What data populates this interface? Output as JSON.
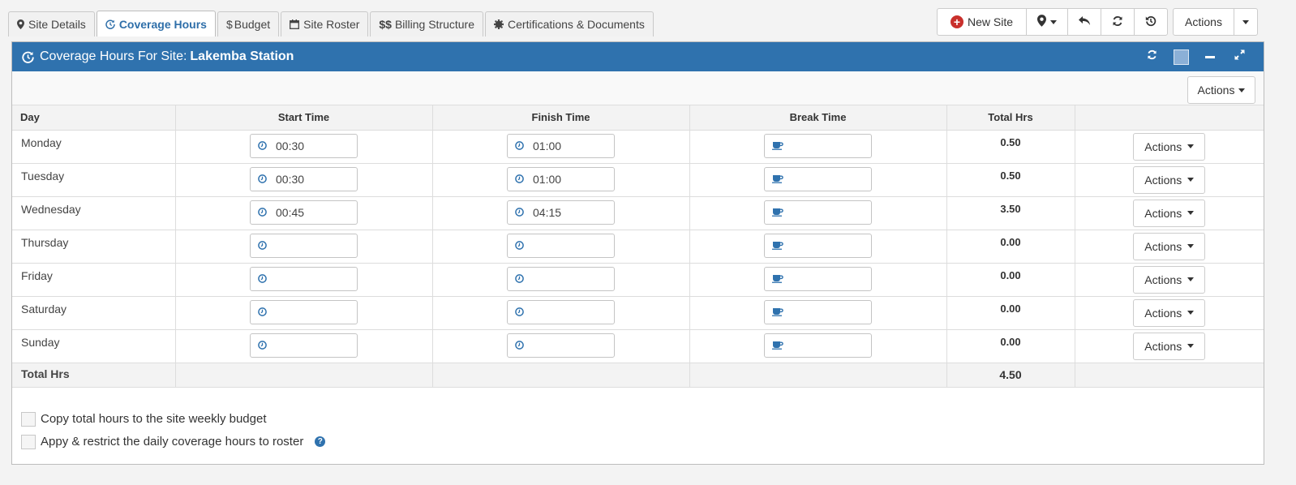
{
  "tabs": [
    {
      "label": "Site Details",
      "icon": "map-marker-icon"
    },
    {
      "label": "Coverage Hours",
      "icon": "clock-refresh-icon"
    },
    {
      "label": "Budget",
      "icon": "dollar-icon"
    },
    {
      "label": "Site Roster",
      "icon": "calendar-icon"
    },
    {
      "label": "Billing Structure",
      "icon": "double-dollar-icon"
    },
    {
      "label": "Certifications & Documents",
      "icon": "certificate-icon"
    }
  ],
  "toolbar": {
    "new_site_label": "New Site",
    "actions_label": "Actions"
  },
  "panel": {
    "title_prefix": "Coverage Hours For Site:",
    "site_name": "Lakemba Station",
    "actions_label": "Actions",
    "header_color": "#2f72ae"
  },
  "table": {
    "headers": [
      "Day",
      "Start Time",
      "Finish Time",
      "Break Time",
      "Total Hrs",
      ""
    ],
    "row_actions_label": "Actions",
    "rows": [
      {
        "day": "Monday",
        "start": "00:30",
        "finish": "01:00",
        "break": "",
        "total": "0.50"
      },
      {
        "day": "Tuesday",
        "start": "00:30",
        "finish": "01:00",
        "break": "",
        "total": "0.50"
      },
      {
        "day": "Wednesday",
        "start": "00:45",
        "finish": "04:15",
        "break": "",
        "total": "3.50"
      },
      {
        "day": "Thursday",
        "start": "",
        "finish": "",
        "break": "",
        "total": "0.00"
      },
      {
        "day": "Friday",
        "start": "",
        "finish": "",
        "break": "",
        "total": "0.00"
      },
      {
        "day": "Saturday",
        "start": "",
        "finish": "",
        "break": "",
        "total": "0.00"
      },
      {
        "day": "Sunday",
        "start": "",
        "finish": "",
        "break": "",
        "total": "0.00"
      }
    ],
    "footer": {
      "label": "Total Hrs",
      "total": "4.50"
    }
  },
  "options": {
    "copy_label": "Copy total hours to the site weekly budget",
    "restrict_label": "Appy & restrict the daily coverage hours to roster"
  }
}
